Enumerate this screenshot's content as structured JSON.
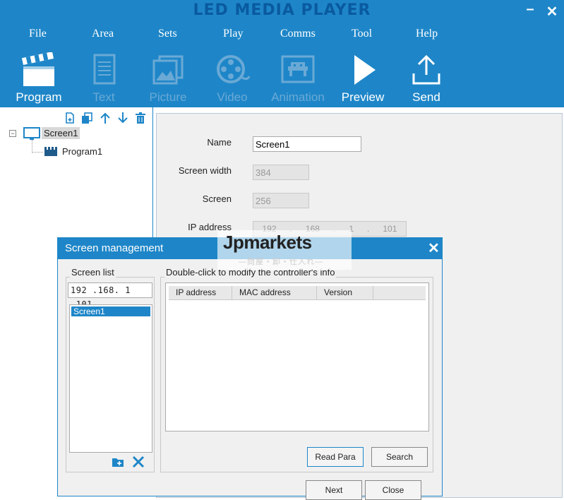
{
  "app": {
    "title": "LED MEDIA PLAYER",
    "minimize_glyph": "–",
    "close_glyph": "✕"
  },
  "menu": [
    "File",
    "Area",
    "Sets",
    "Play",
    "Comms",
    "Tool",
    "Help"
  ],
  "toolbar": [
    {
      "label": "Program",
      "icon": "clapperboard-icon",
      "enabled": true
    },
    {
      "label": "Text",
      "icon": "document-icon",
      "enabled": false
    },
    {
      "label": "Picture",
      "icon": "picture-icon",
      "enabled": false
    },
    {
      "label": "Video",
      "icon": "film-reel-icon",
      "enabled": false
    },
    {
      "label": "Animation",
      "icon": "space-invader-icon",
      "enabled": false
    },
    {
      "label": "Preview",
      "icon": "play-icon",
      "enabled": true
    },
    {
      "label": "Send",
      "icon": "upload-icon",
      "enabled": true
    }
  ],
  "tree": {
    "toolbar_icons": [
      "new-file-icon",
      "copy-icon",
      "arrow-up-icon",
      "arrow-down-icon",
      "trash-icon"
    ],
    "expander": "⊟",
    "screen": "Screen1",
    "program": "Program1"
  },
  "props": {
    "name_label": "Name",
    "name_value": "Screen1",
    "width_label": "Screen width",
    "width_value": "384",
    "height_label": "Screen",
    "height_value": "256",
    "ip_label": "IP address",
    "ip_octets": [
      "192",
      "168",
      "1",
      "101"
    ]
  },
  "dialog": {
    "title": "Screen management",
    "close_glyph": "✕",
    "screen_list_title": "Screen list",
    "screen_ip": "192 .168. 1 .101",
    "screens": [
      "Screen1"
    ],
    "controller_title": "Double-click to modify the controller's info",
    "columns": [
      "IP address",
      "MAC address",
      "Version",
      ""
    ],
    "read_para": "Read Para",
    "search": "Search",
    "next": "Next",
    "close": "Close"
  },
  "watermark": {
    "brand": "Jpmarkets",
    "sub": "—問屋・卸・仕入れ—"
  },
  "colors": {
    "accent": "#1e86c8",
    "title_text": "#0a5aa0"
  }
}
